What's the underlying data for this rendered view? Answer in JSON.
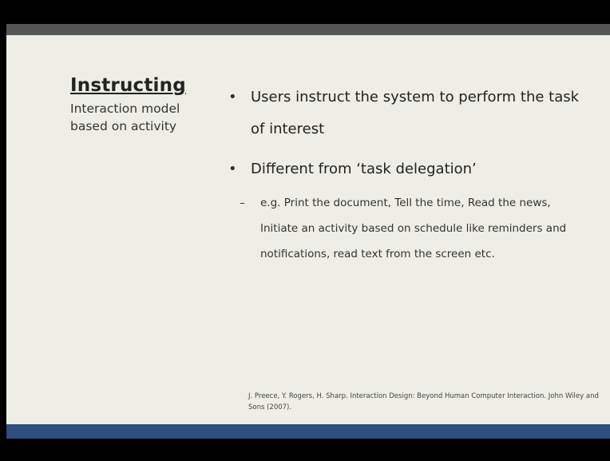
{
  "slide": {
    "title": "Instructing",
    "subtitle": "Interaction model based on activity",
    "bullets": [
      "Users instruct the system to perform the task of interest",
      "Different from ‘task delegation’"
    ],
    "bullet_marker": "•",
    "sub_bullet_marker": "–",
    "sub_bullet": "e.g. Print the document, Tell the time, Read the news, Initiate an activity based on schedule like reminders and notifications, read text from the screen etc.",
    "reference": "J. Preece, Y. Rogers, H. Sharp. Interaction Design: Beyond Human Computer Interaction. John Wiley and Sons (2007)."
  },
  "colors": {
    "background": "#eeeee6",
    "top_bar": "#555657",
    "bottom_bar": "#2d4e7e",
    "frame": "#000000"
  }
}
